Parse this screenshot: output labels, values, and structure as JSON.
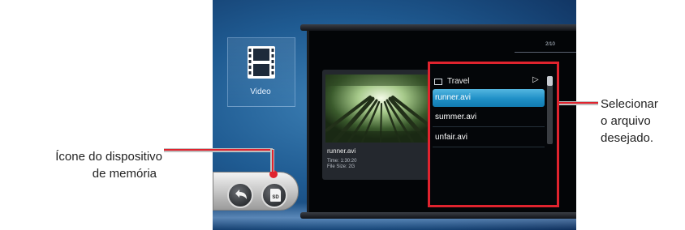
{
  "app": {
    "video_tile_label": "Video",
    "page_indicator": "2/10"
  },
  "preview": {
    "file_name": "runner.avi",
    "time": "Time: 1:30:20",
    "file_size": "File Size: 2G"
  },
  "file_list": {
    "folder_name": "Travel",
    "folder_arrow": "▷",
    "items": [
      {
        "label": "runner.avi",
        "selected": true
      },
      {
        "label": "summer.avi",
        "selected": false
      },
      {
        "label": "unfair.avi",
        "selected": false
      }
    ]
  },
  "bottom_bar": {
    "sd_label": "SD"
  },
  "annotations": {
    "memory_device_line1": "Ícone do dispositivo",
    "memory_device_line2": "de memória",
    "select_file_line1": "Selecionar",
    "select_file_line2": "o arquivo",
    "select_file_line3": "desejado."
  },
  "colors": {
    "callout": "#e0232e",
    "selection": "#1f8fc6"
  },
  "icons": [
    "film-strip-icon",
    "folder-icon",
    "play-arrow-icon",
    "back-arrow-icon",
    "sd-card-icon"
  ]
}
